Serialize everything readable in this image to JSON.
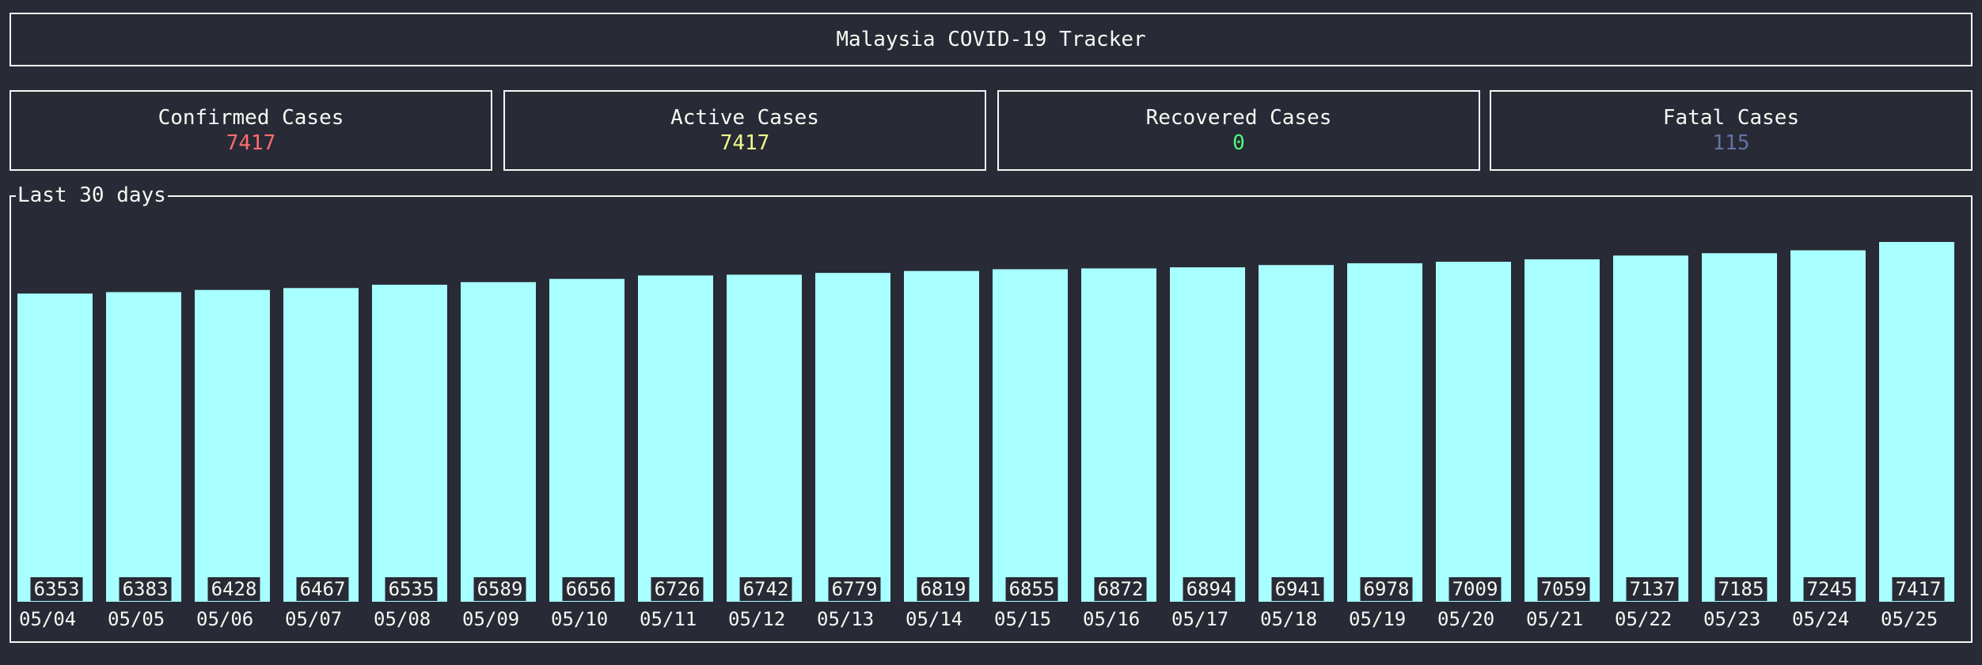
{
  "header": {
    "title": "Malaysia COVID-19 Tracker"
  },
  "stats": {
    "confirmed": {
      "label": "Confirmed Cases",
      "value": "7417",
      "color": "#ff6e6e"
    },
    "active": {
      "label": "Active Cases",
      "value": "7417",
      "color": "#f1fa8c"
    },
    "recovered": {
      "label": "Recovered Cases",
      "value": "0",
      "color": "#50fa7b"
    },
    "fatal": {
      "label": "Fatal Cases",
      "value": "115",
      "color": "#6272a4"
    }
  },
  "chart_title": "Last 30 days",
  "chart_data": {
    "type": "bar",
    "title": "Last 30 days",
    "bar_color": "#a8ffff",
    "categories": [
      "05/04",
      "05/05",
      "05/06",
      "05/07",
      "05/08",
      "05/09",
      "05/10",
      "05/11",
      "05/12",
      "05/13",
      "05/14",
      "05/15",
      "05/16",
      "05/17",
      "05/18",
      "05/19",
      "05/20",
      "05/21",
      "05/22",
      "05/23",
      "05/24",
      "05/25"
    ],
    "values": [
      6353,
      6383,
      6428,
      6467,
      6535,
      6589,
      6656,
      6726,
      6742,
      6779,
      6819,
      6855,
      6872,
      6894,
      6941,
      6978,
      7009,
      7059,
      7137,
      7185,
      7245,
      7417
    ]
  }
}
